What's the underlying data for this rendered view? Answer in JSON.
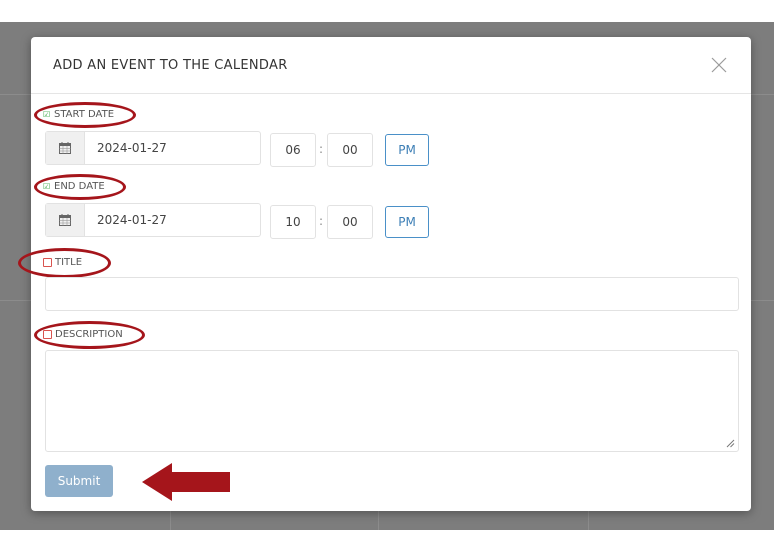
{
  "modal": {
    "title": "ADD AN EVENT TO THE CALENDAR"
  },
  "start": {
    "label": "START DATE",
    "date": "2024-01-27",
    "hour": "06",
    "minute": "00",
    "ampm": "PM"
  },
  "end": {
    "label": "END DATE",
    "date": "2024-01-27",
    "hour": "10",
    "minute": "00",
    "ampm": "PM"
  },
  "title_field": {
    "label": "TITLE",
    "value": ""
  },
  "description_field": {
    "label": "DESCRIPTION",
    "value": ""
  },
  "time_separator": ":",
  "submit_label": "Submit",
  "colors": {
    "annotation": "#a5151b",
    "check": "#39a845",
    "unchecked": "#d9534f",
    "ampm_border": "#4a90c8",
    "submit_bg": "#8fb0cc"
  },
  "icons": [
    "calendar-icon",
    "close-icon",
    "check-icon",
    "resize-grip-icon",
    "arrow-icon"
  ]
}
